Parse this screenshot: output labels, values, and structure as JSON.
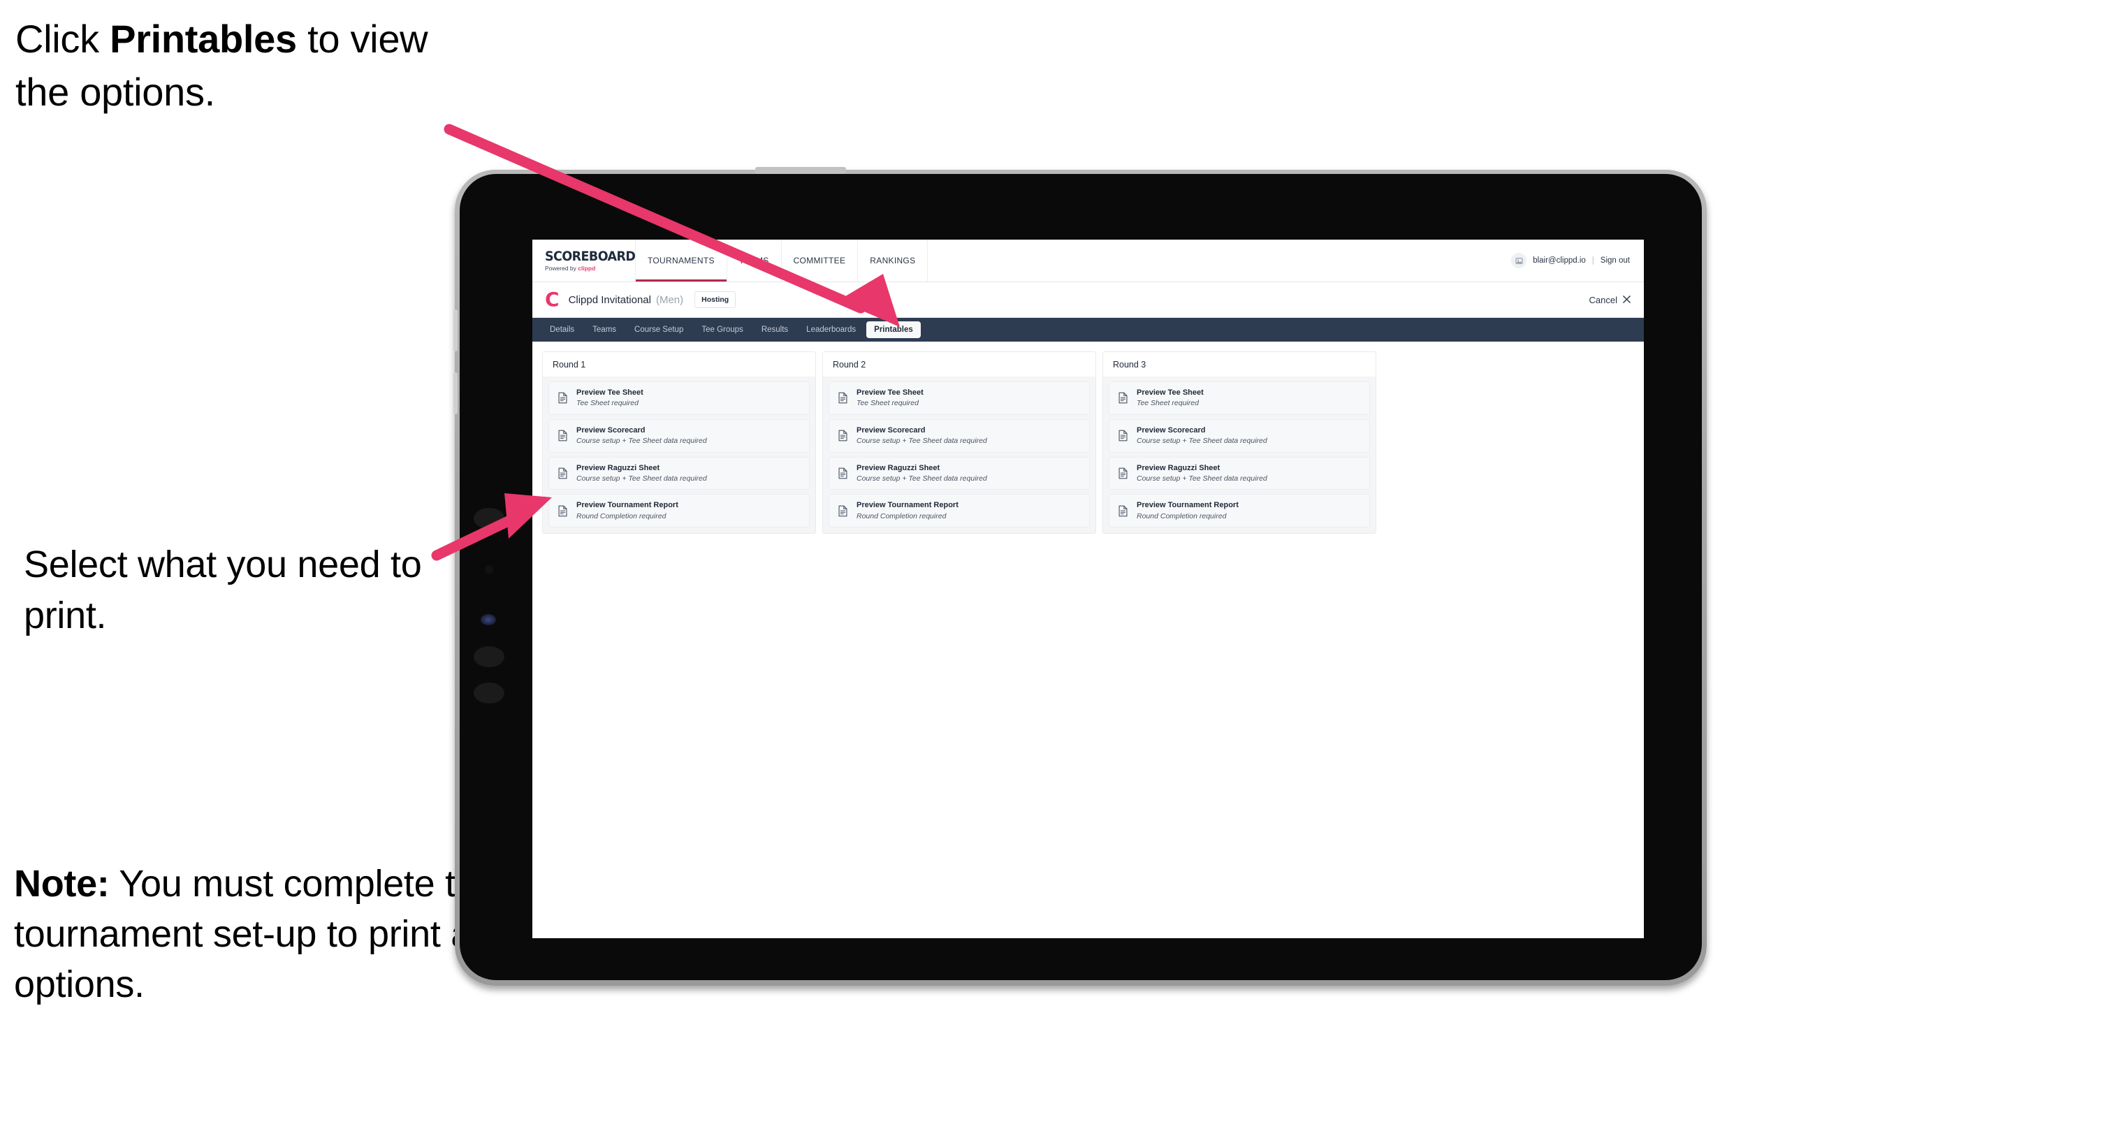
{
  "annotations": {
    "top": {
      "pre": "Click ",
      "bold": "Printables",
      "post": " to view the options."
    },
    "middle": "Select what you need to print.",
    "note": {
      "bold": "Note:",
      "text": " You must complete the tournament set-up to print all the options."
    },
    "arrow_color": "#e8376a"
  },
  "app": {
    "brand": {
      "title": "SCOREBOARD",
      "sub_pre": "Powered by ",
      "sub_brand": "clippd"
    },
    "topnav": [
      {
        "label": "TOURNAMENTS",
        "active": true
      },
      {
        "label": "TEAMS",
        "active": false
      },
      {
        "label": "COMMITTEE",
        "active": false
      },
      {
        "label": "RANKINGS",
        "active": false
      }
    ],
    "account": {
      "avatar_icon": "user-avatar-icon",
      "email": "blair@clippd.io",
      "separator": "|",
      "signout": "Sign out"
    },
    "tournament": {
      "logo_letter": "C",
      "name": "Clippd Invitational",
      "gender": "(Men)",
      "status_badge": "Hosting",
      "cancel_label": "Cancel",
      "cancel_icon": "close-x-icon"
    },
    "tabs": [
      {
        "label": "Details",
        "active": false
      },
      {
        "label": "Teams",
        "active": false
      },
      {
        "label": "Course Setup",
        "active": false
      },
      {
        "label": "Tee Groups",
        "active": false
      },
      {
        "label": "Results",
        "active": false
      },
      {
        "label": "Leaderboards",
        "active": false
      },
      {
        "label": "Printables",
        "active": true
      }
    ],
    "rounds": [
      {
        "heading": "Round 1",
        "items": [
          {
            "icon": "document-icon",
            "title": "Preview Tee Sheet",
            "subtitle": "Tee Sheet required"
          },
          {
            "icon": "document-icon",
            "title": "Preview Scorecard",
            "subtitle": "Course setup + Tee Sheet data required"
          },
          {
            "icon": "document-icon",
            "title": "Preview Raguzzi Sheet",
            "subtitle": "Course setup + Tee Sheet data required"
          },
          {
            "icon": "document-icon",
            "title": "Preview Tournament Report",
            "subtitle": "Round Completion required"
          }
        ]
      },
      {
        "heading": "Round 2",
        "items": [
          {
            "icon": "document-icon",
            "title": "Preview Tee Sheet",
            "subtitle": "Tee Sheet required"
          },
          {
            "icon": "document-icon",
            "title": "Preview Scorecard",
            "subtitle": "Course setup + Tee Sheet data required"
          },
          {
            "icon": "document-icon",
            "title": "Preview Raguzzi Sheet",
            "subtitle": "Course setup + Tee Sheet data required"
          },
          {
            "icon": "document-icon",
            "title": "Preview Tournament Report",
            "subtitle": "Round Completion required"
          }
        ]
      },
      {
        "heading": "Round 3",
        "items": [
          {
            "icon": "document-icon",
            "title": "Preview Tee Sheet",
            "subtitle": "Tee Sheet required"
          },
          {
            "icon": "document-icon",
            "title": "Preview Scorecard",
            "subtitle": "Course setup + Tee Sheet data required"
          },
          {
            "icon": "document-icon",
            "title": "Preview Raguzzi Sheet",
            "subtitle": "Course setup + Tee Sheet data required"
          },
          {
            "icon": "document-icon",
            "title": "Preview Tournament Report",
            "subtitle": "Round Completion required"
          }
        ]
      }
    ],
    "colors": {
      "tabbar_bg": "#2e3c52",
      "brand_pink": "#e8376a",
      "active_underline": "#b02a4a"
    }
  }
}
